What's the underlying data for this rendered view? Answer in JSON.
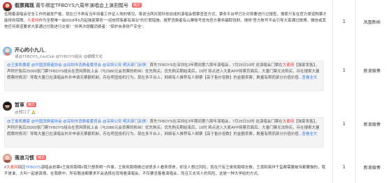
{
  "rows": [
    {
      "name": "假票揭现",
      "title": "莆牛绑定TFBOYS六周年演唱会上演割瓢号",
      "badge": "精华",
      "text_a": "伍随着演唱会安全工作的越发严格，现在已不再有当年持着工作证入场的情况。虽说当两对现科技加成的演唱会假票查查方式，票务平台早已针对将要进行过搜查，搜索只有在官方渠道购票才能得到保障。",
      "text_hl": "大麦网",
      "text_b": "作为全程唯一由2018年5月起独家票务\"一经校转售都有商业\"的打假措施，搜罗消费者有山寨账号冒充官方票务骗取钱财，搜得\"官方账号不会引导大家通过微博、微信或其他任何渠道要求大家通过付款进行交易！\"并再次提醒消费者：",
      "text_end": "\"保护自身财产安全\"。",
      "num": "1",
      "category": "凤凰新闻"
    },
    {
      "name": "开心的小九儿_",
      "sub": "请@TFBOYS_FanClub @TFBOYS组合 @蝴蝶文化",
      "quote_pre": "@王俊凯搬家 @中国消费者协会 @深圳市消费者委员会 @深圳公安 明天部门反馈：",
      "quote_mid": "首先TFBOYS在深圳在3年期间第六周年演唱会，7月25日10时 这演唱会门票在",
      "quote_hl": "大麦网",
      "quote_b": "【独家发售】，声称开售后25000张门票TFBOYS组合在官网首批上会（与2986元会员票的粉丝）优先购买。优先购买期结束后，10时 将点进入大麦APP将票页面后，大量门票无法购买，存在搜索大量假票的情况！导致大量已在演唱会外并申请无票额机制，存在明显投机行为。",
      "quote_end": "现在多平台上，网络有人推荐有人倒票【高于售价倍数】的金额卖票，数量有限而部分价值价值",
      "more": "...查看全文",
      "num": "1",
      "category": "新浪微博"
    },
    {
      "name": "暂草",
      "badge": "精华",
      "sub": "@郑口了 🙏",
      "quote_pre": "@王俊凯搬家 @中国消费者协会 @深圳市消费者委员会 @深圳公安 明天部门反馈：",
      "quote_mid": "首先TFBOYS在深圳在3年期间第六周年演唱会，7月25日10时 这演唱会门票在",
      "quote_hl": "大麦网",
      "quote_b": "【独家发售】，声称开售后25000张门票TFBOYS组合在官网首批上会（与2986元会员票的粉丝）优先购买。优先购买期结束后，10时 将点进入大麦APP将票页面后，大量门票无法购买，存在搜索大量假票的情况！导致大量已在演唱会外并申请无票额机制，存在明显投机行为。",
      "quote_end": "现在多平台上，网络有人推荐有人倒票【高于售价倍数】的金额卖票，数量有限而部分价值价值",
      "more": "...查看全文",
      "num": "1",
      "category": "新浪微博"
    },
    {
      "name": "落浪习惯",
      "badge": "精华",
      "text_pre": "#",
      "text_hl": "大麦网",
      "text_a": "回应",
      "text_lnk": "TFBOYS",
      "text_b": "演唱会抢票#王俊凯跑喂#我只想表明一件事，王俊凯跑喂做过说很多人看来很贵，却没人想过风险，现在只有王俊凯跑喂去做，王源和易烊千玺都需要被骂都要做的，我不是谁，大叫一起是真情，在我眼中，所有歌迷都要求不会选择在现场看演唱会，不仅要坐着看演唱会，而且又去骂人的风险，这是一种大学给的方式。",
      "num": "1",
      "category": "新浪微博"
    }
  ]
}
